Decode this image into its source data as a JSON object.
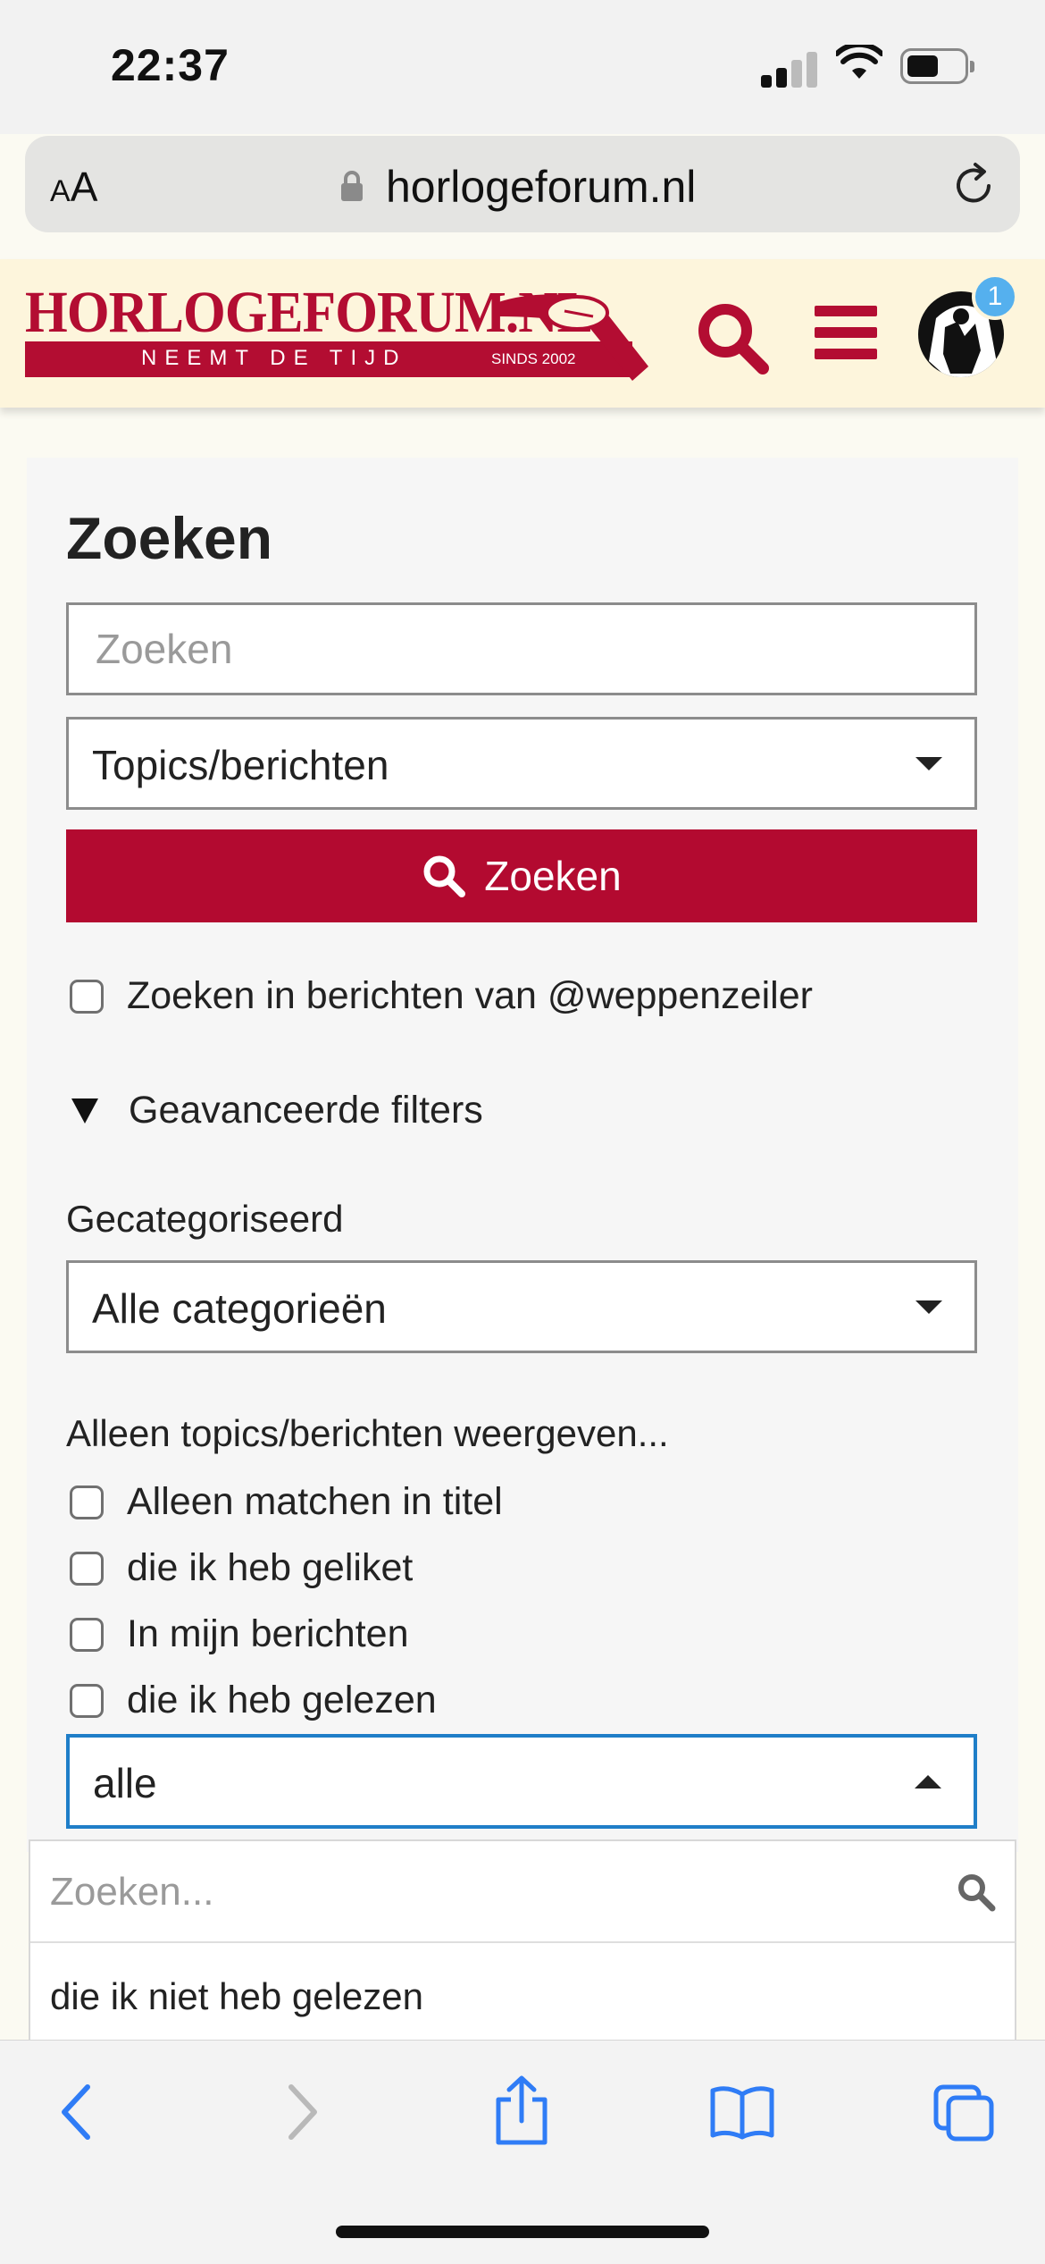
{
  "status_bar": {
    "time": "22:37"
  },
  "browser": {
    "text_size_label_small": "A",
    "text_size_label_large": "A",
    "url": "horlogeforum.nl"
  },
  "header": {
    "logo_title": "HORLOGEFORUM.NL",
    "logo_tagline": "NEEMT DE TIJD",
    "logo_since": "SINDS 2002",
    "notification_count": "1"
  },
  "search": {
    "title": "Zoeken",
    "input_placeholder": "Zoeken",
    "type_select_value": "Topics/berichten",
    "button_label": "Zoeken",
    "search_in_posts_label": "Zoeken in berichten van @weppenzeiler",
    "advanced_filters_label": "Geavanceerde filters",
    "category_label": "Gecategoriseerd",
    "category_value": "Alle categorieën",
    "only_show_label": "Alleen topics/berichten weergeven...",
    "filters": [
      "Alleen matchen in titel",
      "die ik heb geliket",
      "In mijn berichten",
      "die ik heb gelezen"
    ],
    "read_select_value": "alle"
  },
  "dropdown": {
    "search_placeholder": "Zoeken...",
    "options": [
      "die ik niet heb gelezen"
    ]
  },
  "colors": {
    "brand": "#b30a30",
    "focus": "#1f7ec8",
    "ios_blue": "#2f7cf6",
    "header_bg": "#fdf5dc"
  },
  "icons": [
    "signal-icon",
    "wifi-icon",
    "battery-icon",
    "lock-icon",
    "reload-icon",
    "search-icon",
    "menu-icon",
    "back-icon",
    "forward-icon",
    "share-icon",
    "bookmarks-icon",
    "tabs-icon"
  ]
}
